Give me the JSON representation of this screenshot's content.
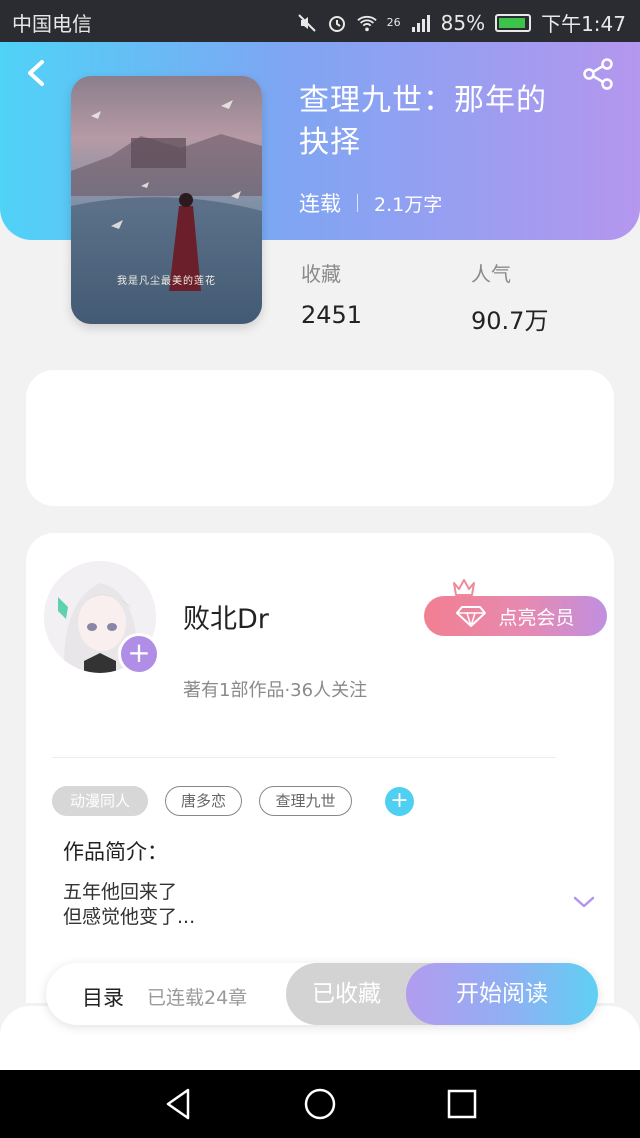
{
  "status_bar": {
    "carrier": "中国电信",
    "network": "26",
    "battery_percent": "85%",
    "time": "下午1:47"
  },
  "header": {
    "back_icon": "chevron-left-icon",
    "share_icon": "share-icon"
  },
  "book": {
    "title_line1": "查理九世：那年的",
    "title_line2": "抉择",
    "status": "连载",
    "word_count": "2.1万字",
    "cover_caption": "我是凡尘最美的莲花",
    "favorites_label": "收藏",
    "favorites_value": "2451",
    "popularity_label": "人气",
    "popularity_value": "90.7万"
  },
  "author": {
    "name": "败北Dr",
    "stats": "著有1部作品·36人关注",
    "follow_icon": "plus-icon",
    "vip_label": "点亮会员",
    "vip_icon": "diamond-icon"
  },
  "tags": [
    "动漫同人",
    "唐多恋",
    "查理九世"
  ],
  "intro": {
    "title": "作品简介：",
    "line1": "五年他回来了",
    "line2": "但感觉他变了..."
  },
  "actions": {
    "catalog": "目录",
    "chapters": "已连载24章",
    "favorited": "已收藏",
    "start_reading": "开始阅读"
  },
  "colors": {
    "header_gradient_start": "#4fd3f7",
    "header_gradient_end": "#b497ee",
    "accent_cyan": "#4fcff2",
    "accent_purple": "#b08ee6",
    "vip_pink": "#f27f91"
  }
}
